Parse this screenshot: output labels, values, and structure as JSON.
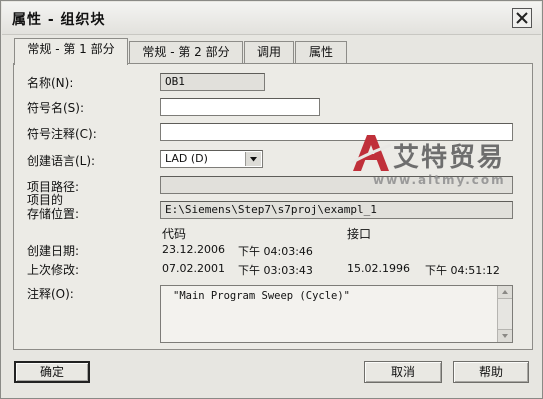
{
  "window": {
    "title": "属性 - 组织块"
  },
  "tabs": [
    {
      "label": "常规 - 第 1 部分",
      "active": true
    },
    {
      "label": "常规 - 第 2 部分",
      "active": false
    },
    {
      "label": "调用",
      "active": false
    },
    {
      "label": "属性",
      "active": false
    }
  ],
  "form": {
    "name_label": "名称(N):",
    "name_value": "OB1",
    "symbol_name_label": "符号名(S):",
    "symbol_name_value": "",
    "symbol_comment_label": "符号注释(C):",
    "symbol_comment_value": "",
    "language_label": "创建语言(L):",
    "language_value": "LAD (D)",
    "project_path_label": "项目路径:",
    "project_path_value": "",
    "storage_label_line1": "项目的",
    "storage_label_line2": "存储位置:",
    "storage_value": "E:\\Siemens\\Step7\\s7proj\\exampl_1",
    "col_code": "代码",
    "col_interface": "接口",
    "created_label": "创建日期:",
    "created_code_date": "23.12.2006",
    "created_code_time": "下午 04:03:46",
    "modified_label": "上次修改:",
    "modified_code_date": "07.02.2001",
    "modified_code_time": "下午 03:03:43",
    "modified_interface_date": "15.02.1996",
    "modified_interface_time": "下午 04:51:12",
    "comment_label": "注释(O):",
    "comment_value": "\"Main Program Sweep (Cycle)\""
  },
  "buttons": {
    "ok": "确定",
    "cancel": "取消",
    "help": "帮助"
  },
  "watermark": {
    "title": "艾特贸易",
    "url": "www.aitmy.com",
    "logo_color": "#c0303a"
  },
  "icons": {
    "close": "close-icon",
    "dropdown": "chevron-down-icon",
    "scroll_up": "scroll-up-icon",
    "scroll_down": "scroll-down-icon",
    "logo": "a-letter-logo-icon"
  }
}
